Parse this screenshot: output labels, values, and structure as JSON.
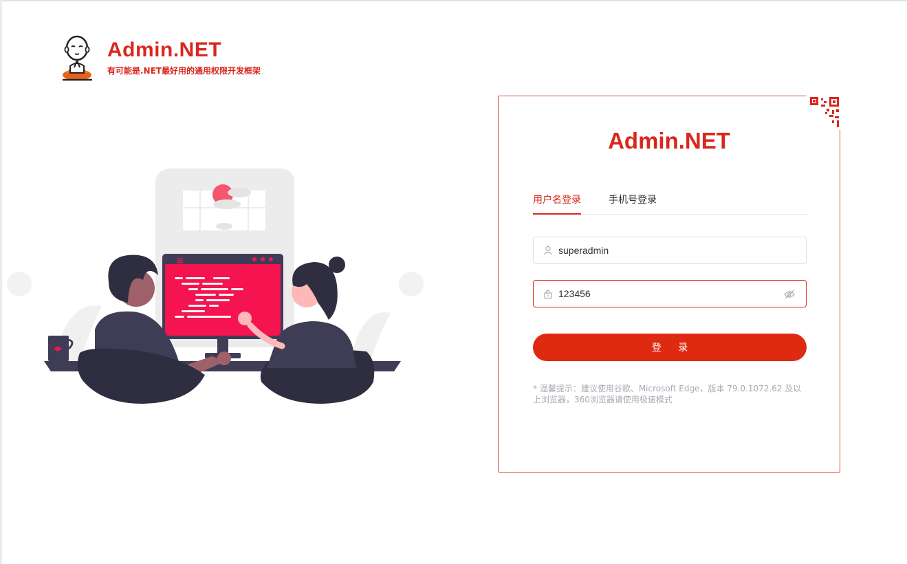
{
  "brand": {
    "title": "Admin.NET",
    "subtitle": "有可能是.NET最好用的通用权限开发框架"
  },
  "login": {
    "title": "Admin.NET",
    "tabs": [
      {
        "label": "用户名登录",
        "active": true
      },
      {
        "label": "手机号登录",
        "active": false
      }
    ],
    "username": {
      "value": "superadmin",
      "icon": "user-icon"
    },
    "password": {
      "value": "123456",
      "icon": "lock-icon",
      "toggle_icon": "eye-icon"
    },
    "submit_label": "登 录",
    "tip": "* 温馨提示：建议使用谷歌、Microsoft Edge，版本 79.0.1072.62 及以上浏览器，360浏览器请使用极速模式"
  },
  "colors": {
    "accent": "#d9271e",
    "button": "#df2a12",
    "screen": "#f5144f",
    "figure_dark": "#2f2e41"
  }
}
